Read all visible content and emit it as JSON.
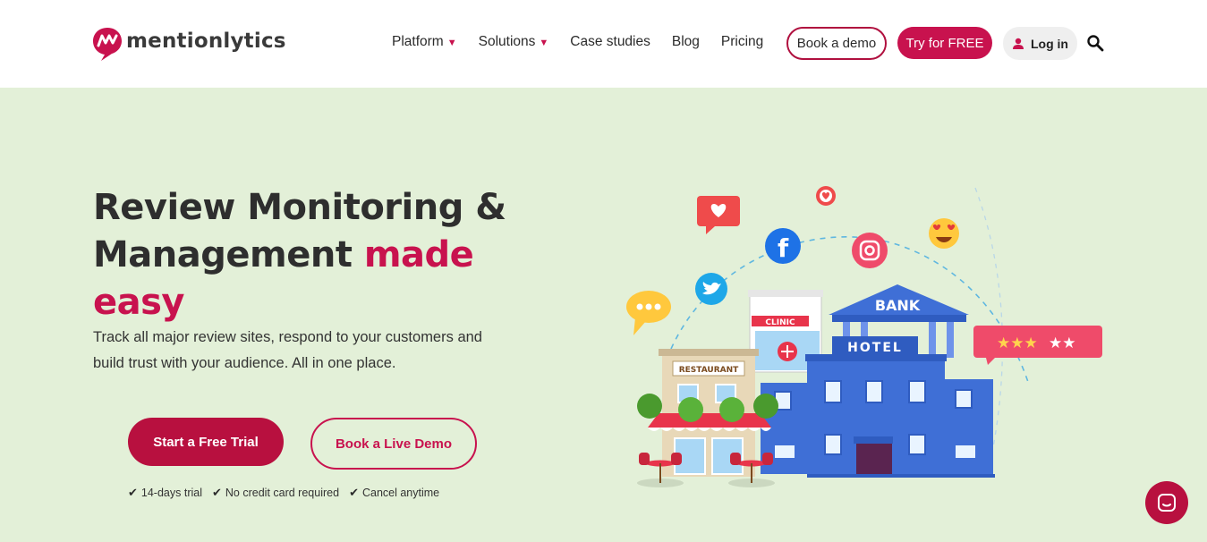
{
  "brand": {
    "name": "mentionlytics",
    "accent": "#c8124e",
    "background": "#e3f0d8"
  },
  "nav": {
    "items": [
      {
        "label": "Platform",
        "dropdown": true
      },
      {
        "label": "Solutions",
        "dropdown": true
      },
      {
        "label": "Case studies",
        "dropdown": false
      },
      {
        "label": "Blog",
        "dropdown": false
      },
      {
        "label": "Pricing",
        "dropdown": false
      }
    ],
    "caret": "▼",
    "book_demo": "Book a demo",
    "try_free": "Try for FREE",
    "login": "Log in",
    "search_icon": "search-icon"
  },
  "hero": {
    "title_line1": "Review Monitoring &",
    "title_line2": "Management",
    "title_accent1": "made",
    "title_accent2": "easy",
    "subtitle": "Track all major review sites, respond to your customers and build trust with your audience. All in one place.",
    "cta_primary": "Start a Free Trial",
    "cta_secondary": "Book a Live Demo",
    "perks": [
      "14-days trial",
      "No credit card required",
      "Cancel anytime"
    ]
  },
  "illustration": {
    "signs": {
      "bank": "BANK",
      "hotel": "HOTEL",
      "clinic": "CLINIC",
      "restaurant": "RESTAURANT"
    },
    "rating_stars": 5
  },
  "chat_widget": {
    "icon": "chat-icon"
  }
}
